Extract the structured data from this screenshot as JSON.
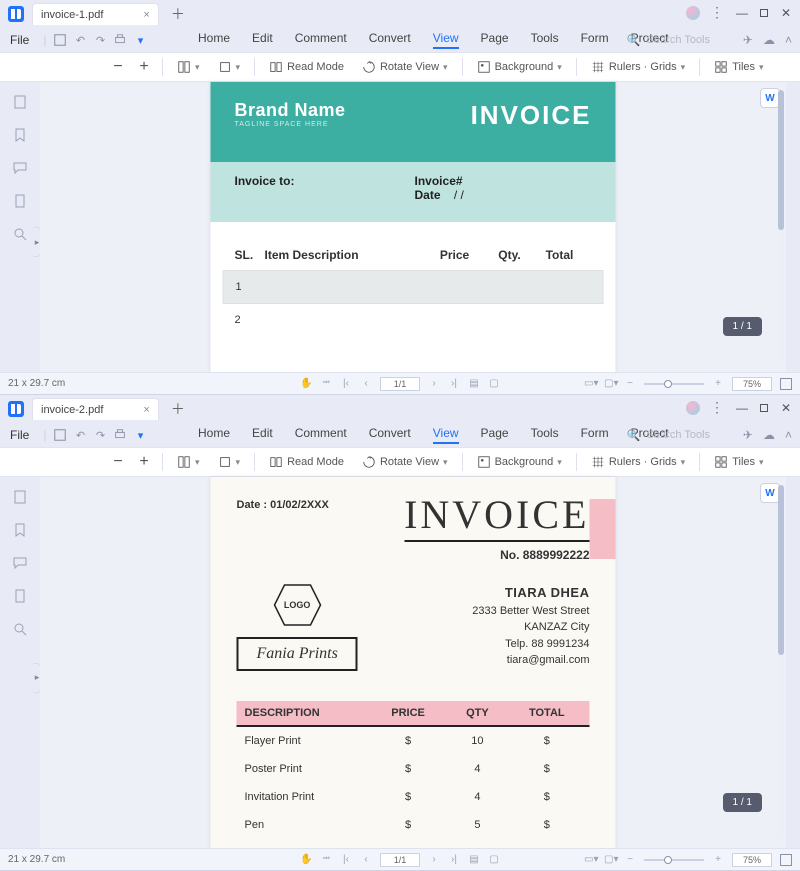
{
  "windows": [
    {
      "tab_name": "invoice-1.pdf",
      "file_menu": "File",
      "menus": [
        "Home",
        "Edit",
        "Comment",
        "Convert",
        "View",
        "Page",
        "Tools",
        "Form",
        "Protect"
      ],
      "active_menu": "View",
      "search_placeholder": "Search Tools",
      "toolbar": {
        "read_mode": "Read Mode",
        "rotate_view": "Rotate View",
        "background": "Background",
        "rulers_grids": "Rulers · Grids",
        "tiles": "Tiles"
      },
      "status": {
        "dims": "21 x 29.7 cm",
        "page": "1/1",
        "page_caption": "1 / 1",
        "zoom": "75%"
      },
      "document": {
        "brand": "Brand Name",
        "tagline": "TAGLINE SPACE HERE",
        "title": "INVOICE",
        "invoice_to_label": "Invoice to:",
        "invoice_num_label": "Invoice#",
        "date_label": "Date",
        "date_value": "/      /",
        "columns": {
          "sl": "SL.",
          "desc": "Item Description",
          "price": "Price",
          "qty": "Qty.",
          "total": "Total"
        },
        "rows": [
          {
            "sl": "1"
          },
          {
            "sl": "2"
          }
        ]
      }
    },
    {
      "tab_name": "invoice-2.pdf",
      "file_menu": "File",
      "menus": [
        "Home",
        "Edit",
        "Comment",
        "Convert",
        "View",
        "Page",
        "Tools",
        "Form",
        "Protect"
      ],
      "active_menu": "View",
      "search_placeholder": "Search Tools",
      "toolbar": {
        "read_mode": "Read Mode",
        "rotate_view": "Rotate View",
        "background": "Background",
        "rulers_grids": "Rulers · Grids",
        "tiles": "Tiles"
      },
      "status": {
        "dims": "21 x 29.7 cm",
        "page": "1/1",
        "page_caption": "1 / 1",
        "zoom": "75%"
      },
      "document": {
        "date_label": "Date : 01/02/2XXX",
        "title": "INVOICE",
        "invoice_no": "No. 8889992222",
        "logo_text": "LOGO",
        "company": "Fania Prints",
        "client": {
          "name": "TIARA DHEA",
          "addr1": "2333 Better West Street",
          "addr2": "KANZAZ City",
          "tel": "Telp. 88 9991234",
          "email": "tiara@gmail.com"
        },
        "columns": {
          "desc": "DESCRIPTION",
          "price": "PRICE",
          "qty": "QTY",
          "total": "TOTAL"
        },
        "rows": [
          {
            "desc": "Flayer Print",
            "price": "$",
            "qty": "10",
            "total": "$"
          },
          {
            "desc": "Poster Print",
            "price": "$",
            "qty": "4",
            "total": "$"
          },
          {
            "desc": "Invitation Print",
            "price": "$",
            "qty": "4",
            "total": "$"
          },
          {
            "desc": "Pen",
            "price": "$",
            "qty": "5",
            "total": "$"
          }
        ]
      }
    }
  ]
}
